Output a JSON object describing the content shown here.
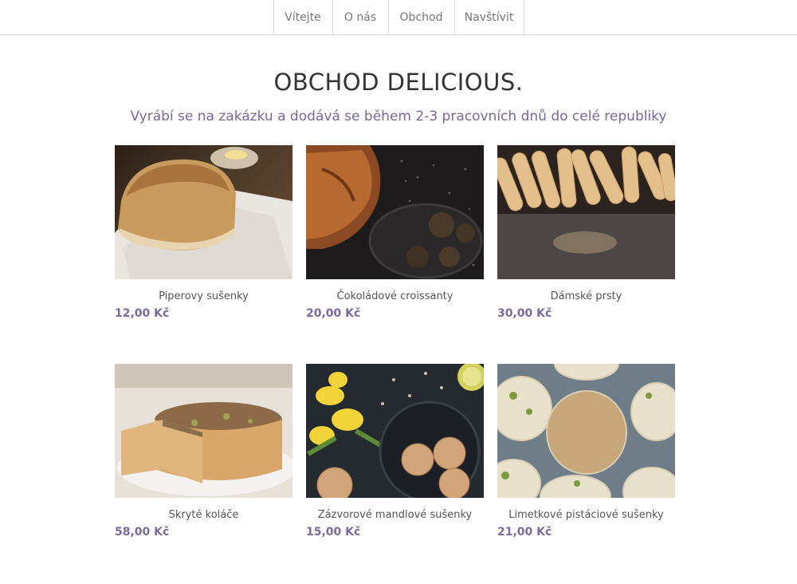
{
  "nav": {
    "items": [
      "Vítejte",
      "O nás",
      "Obchod",
      "Navštívit"
    ]
  },
  "header": {
    "title": "OBCHOD DELICIOUS.",
    "subtitle": "Vyrábí se na zakázku a dodává se během 2-3 pracovních dnů do celé republiky"
  },
  "products": [
    {
      "name": "Piperovy sušenky",
      "price": "12,00 Kč"
    },
    {
      "name": "Čokoládové croissanty",
      "price": "20,00 Kč"
    },
    {
      "name": "Dámské prsty",
      "price": "30,00 Kč"
    },
    {
      "name": "Skryté koláče",
      "price": "58,00 Kč"
    },
    {
      "name": "Zázvorové mandlové sušenky",
      "price": "15,00 Kč"
    },
    {
      "name": "Limetkové pistáciové sušenky",
      "price": "21,00 Kč"
    }
  ],
  "colors": {
    "accent": "#7b6a9e",
    "subtitle": "#7a679a",
    "divider": "#d9d9d9"
  }
}
